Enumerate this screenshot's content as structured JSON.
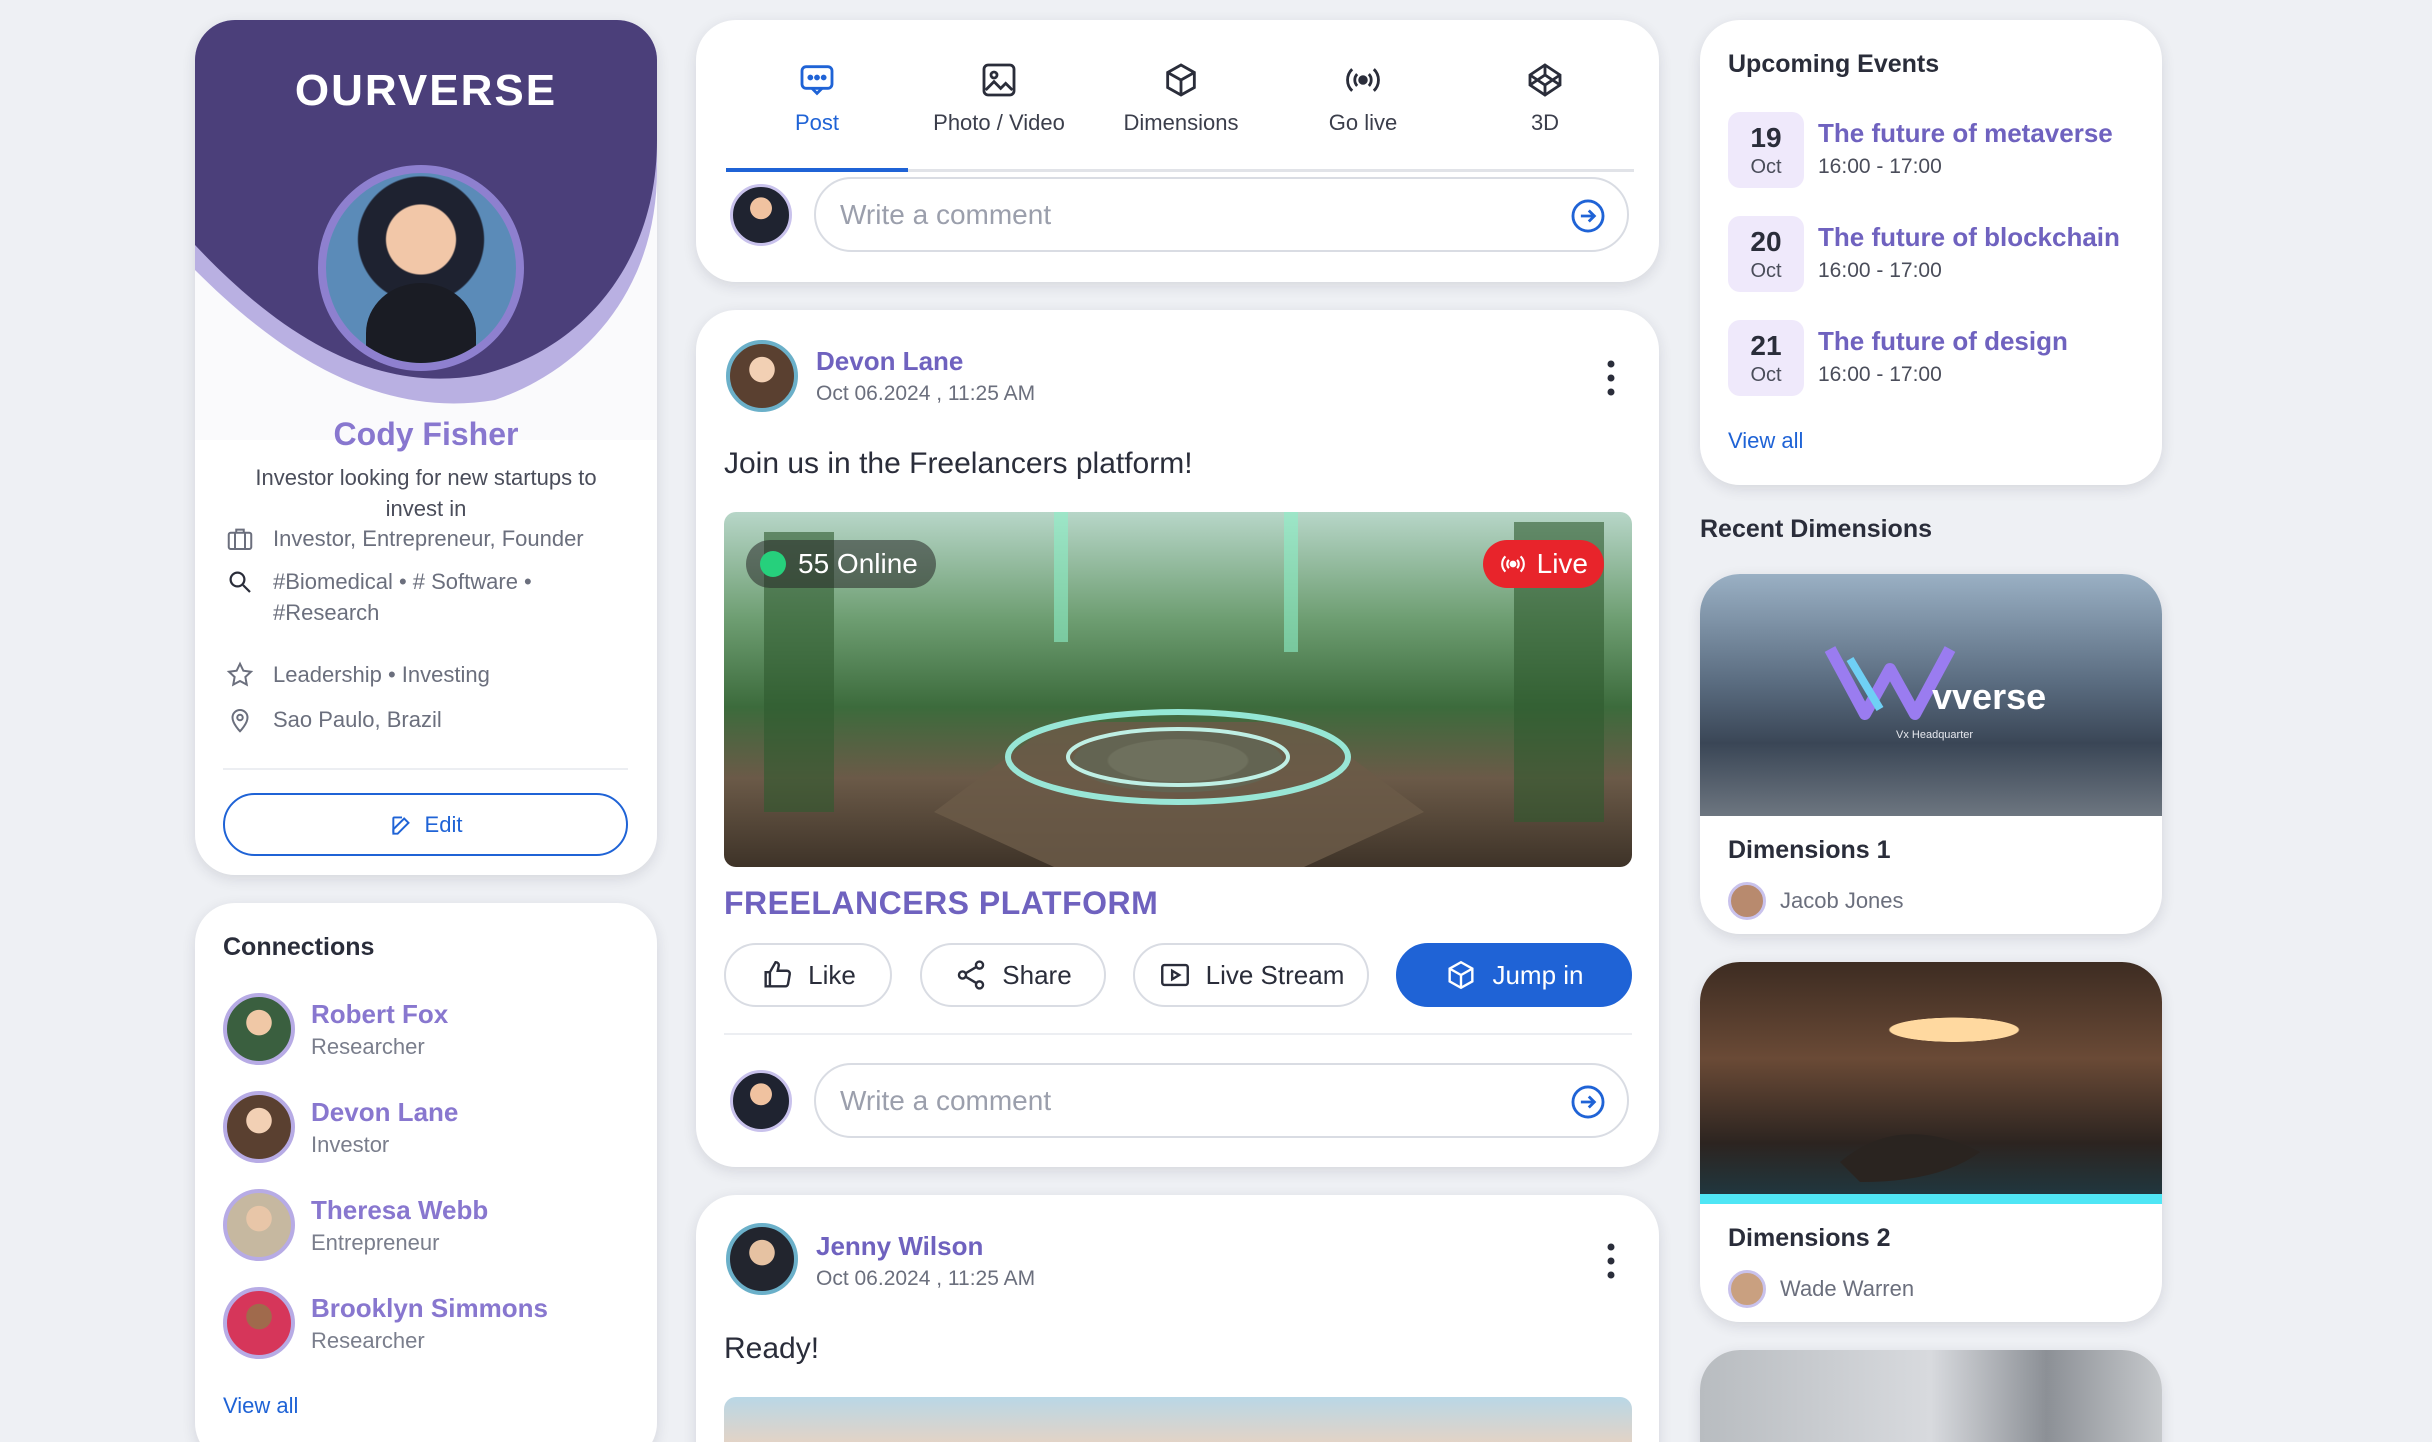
{
  "profile": {
    "logo_text": "OURVERSE",
    "name": "Cody Fisher",
    "bio": "Investor looking for new startups to invest in",
    "roles": "Investor, Entrepreneur, Founder",
    "interests": "#Biomedical • # Software • #Research",
    "skills": "Leadership  • Investing",
    "location": "Sao Paulo, Brazil",
    "edit_label": "Edit"
  },
  "connections": {
    "title": "Connections",
    "items": [
      {
        "name": "Robert Fox",
        "role": "Researcher"
      },
      {
        "name": "Devon Lane",
        "role": "Investor"
      },
      {
        "name": "Theresa Webb",
        "role": "Entrepreneur"
      },
      {
        "name": "Brooklyn Simmons",
        "role": "Researcher"
      }
    ],
    "view_all": "View all"
  },
  "composer": {
    "tabs": [
      {
        "label": "Post",
        "icon": "chat-bubble-icon"
      },
      {
        "label": "Photo / Video",
        "icon": "image-icon"
      },
      {
        "label": "Dimensions",
        "icon": "cube-icon"
      },
      {
        "label": "Go live",
        "icon": "broadcast-icon"
      },
      {
        "label": "3D",
        "icon": "codepen-3d-icon"
      }
    ],
    "comment_placeholder": "Write a comment"
  },
  "posts": [
    {
      "author": "Devon Lane",
      "time": "Oct 06.2024 , 11:25 AM",
      "text": "Join us in the Freelancers platform!",
      "online": "55 Online",
      "live": "Live",
      "heading": "FREELANCERS PLATFORM",
      "actions": {
        "like": "Like",
        "share": "Share",
        "live_stream": "Live Stream",
        "jump_in": "Jump in"
      },
      "comment_placeholder": "Write a comment"
    },
    {
      "author": "Jenny Wilson",
      "time": "Oct 06.2024 , 11:25 AM",
      "text": "Ready!"
    }
  ],
  "events": {
    "title": "Upcoming Events",
    "items": [
      {
        "day": "19",
        "month": "Oct",
        "title": "The future of metaverse",
        "time": "16:00 - 17:00"
      },
      {
        "day": "20",
        "month": "Oct",
        "title": "The future of blockchain",
        "time": "16:00 - 17:00"
      },
      {
        "day": "21",
        "month": "Oct",
        "title": "The future of design",
        "time": "16:00 - 17:00"
      }
    ],
    "view_all": "View all"
  },
  "recent_dimensions": {
    "title": "Recent Dimensions",
    "items": [
      {
        "title": "Dimensions 1",
        "owner": "Jacob Jones",
        "image_text": "vverse",
        "image_subtext": "Vx Headquarter"
      },
      {
        "title": "Dimensions 2",
        "owner": "Wade Warren"
      }
    ]
  },
  "colors": {
    "accent_blue": "#1f63d6",
    "brand_purple": "#4b3f7a",
    "name_purple": "#7a6bc7",
    "live_red": "#e8242b",
    "online_green": "#26d07c"
  }
}
